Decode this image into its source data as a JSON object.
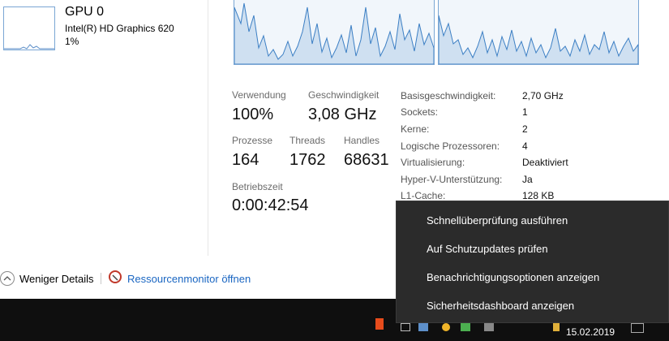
{
  "gpu": {
    "title": "GPU 0",
    "subtitle": "Intel(R) HD Graphics 620",
    "usage": "1%"
  },
  "stats": {
    "verwendung_label": "Verwendung",
    "verwendung_value": "100%",
    "geschw_label": "Geschwindigkeit",
    "geschw_value": "3,08 GHz",
    "prozesse_label": "Prozesse",
    "prozesse_value": "164",
    "threads_label": "Threads",
    "threads_value": "1762",
    "handles_label": "Handles",
    "handles_value": "68631",
    "betrieb_label": "Betriebszeit",
    "betrieb_value": "0:00:42:54"
  },
  "specs": [
    {
      "key": "Basisgeschwindigkeit:",
      "value": "2,70 GHz"
    },
    {
      "key": "Sockets:",
      "value": "1"
    },
    {
      "key": "Kerne:",
      "value": "2"
    },
    {
      "key": "Logische Prozessoren:",
      "value": "4"
    },
    {
      "key": "Virtualisierung:",
      "value": "Deaktiviert"
    },
    {
      "key": "Hyper-V-Unterstützung:",
      "value": "Ja"
    },
    {
      "key": "L1-Cache:",
      "value": "128 KB"
    }
  ],
  "footer": {
    "less_details": "Weniger Details",
    "resource_monitor": "Ressourcenmonitor öffnen"
  },
  "context_menu": [
    "Schnellüberprüfung ausführen",
    "Auf Schutzupdates prüfen",
    "Benachrichtigungsoptionen anzeigen",
    "Sicherheitsdashboard anzeigen"
  ],
  "taskbar": {
    "date": "15.02.2019"
  },
  "colors": {
    "graph_line": "#3c7fc4",
    "graph_fill": "#cfe0f1",
    "menu_bg": "#2b2b2b",
    "taskbar_bg": "#0f0f0f",
    "link": "#1a66c2"
  }
}
